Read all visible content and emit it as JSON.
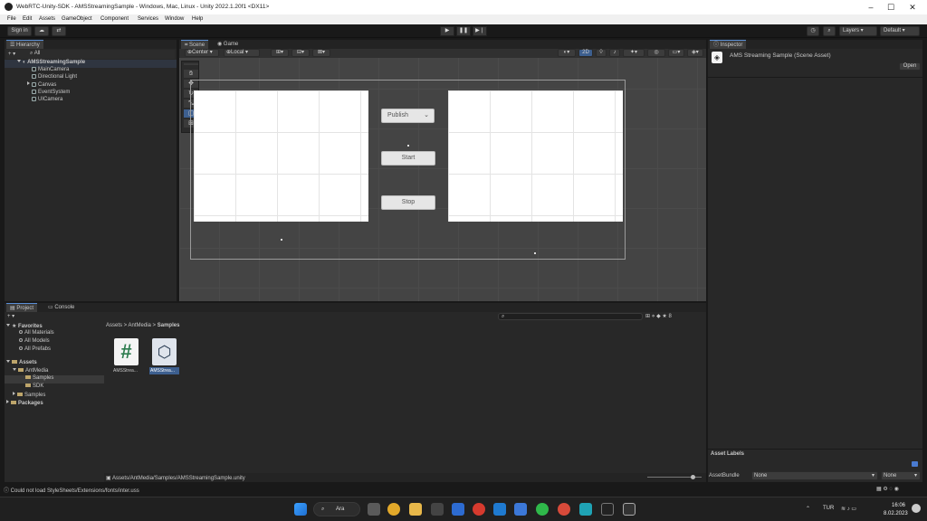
{
  "window": {
    "title": "WebRTC-Unity-SDK - AMSStreamingSample - Windows, Mac, Linux - Unity 2022.1.20f1 <DX11>"
  },
  "menu": [
    "File",
    "Edit",
    "Assets",
    "GameObject",
    "Component",
    "Services",
    "Window",
    "Help"
  ],
  "toolbar": {
    "sign_in": "Sign in",
    "layers": "Layers",
    "layout": "Default"
  },
  "hierarchy": {
    "tab": "Hierarchy",
    "scene": "AMSStreamingSample",
    "items": [
      "MainCamera",
      "Directional Light",
      "Canvas",
      "EventSystem",
      "UICamera"
    ]
  },
  "scene_view": {
    "tabs": [
      "Scene",
      "Game"
    ],
    "pivot": "Center",
    "space": "Local",
    "mode_2d": "2D",
    "buttons": {
      "publish": "Publish",
      "start": "Start",
      "stop": "Stop"
    }
  },
  "inspector": {
    "tab": "Inspector",
    "asset_title": "AMS Streaming Sample (Scene Asset)",
    "open_button": "Open"
  },
  "asset_labels": {
    "title": "Asset Labels",
    "bundle_label": "AssetBundle",
    "bundle_value": "None",
    "variant_value": "None"
  },
  "project": {
    "tabs": [
      "Project",
      "Console"
    ],
    "favorites_title": "Favorites",
    "favorites": [
      "All Materials",
      "All Models",
      "All Prefabs"
    ],
    "assets_title": "Assets",
    "tree": [
      "AntMedia",
      "Samples",
      "SDK",
      "Samples"
    ],
    "packages": "Packages",
    "breadcrumb": [
      "Assets",
      "AntMedia",
      "Samples"
    ],
    "files": [
      {
        "name": "AMSStrea...",
        "icon": "csharp-script-icon"
      },
      {
        "name": "AMSStrea...",
        "icon": "unity-scene-icon"
      }
    ],
    "path": "Assets/AntMedia/Samples/AMSStreamingSample.unity",
    "count": "8"
  },
  "status": {
    "message": "Could not load StyleSheets/Extensions/fonts/inter.uss"
  },
  "taskbar": {
    "search": "Ara",
    "lang": "TUR",
    "time": "16:06",
    "date": "8.02.2023"
  }
}
